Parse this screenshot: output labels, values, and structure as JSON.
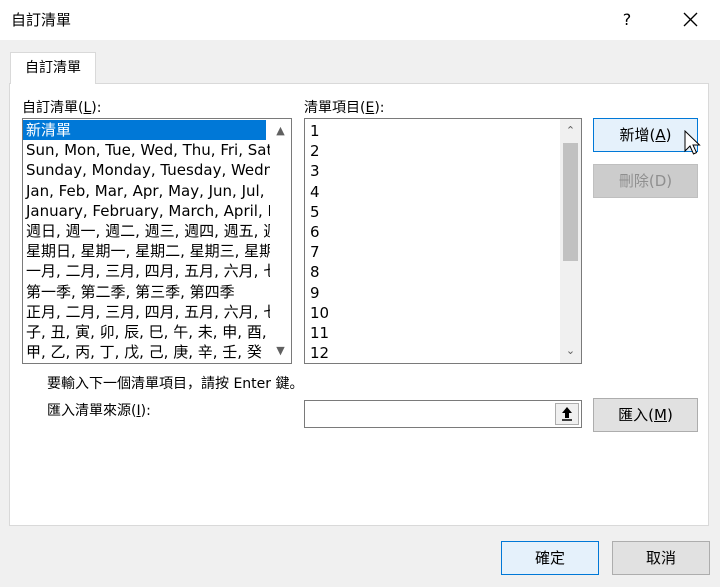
{
  "dialog": {
    "title": "自訂清單",
    "help_glyph": "?",
    "tab_label": "自訂清單"
  },
  "custom_lists": {
    "label_prefix": "自訂清單(",
    "label_key": "L",
    "label_suffix": "):",
    "items": [
      "新清單",
      "Sun, Mon, Tue, Wed, Thu, Fri, Sat",
      "Sunday, Monday, Tuesday, Wedn",
      "Jan, Feb, Mar, Apr, May, Jun, Jul, ",
      "January, February, March, April, M",
      "週日, 週一, 週二, 週三, 週四, 週五, 週",
      "星期日, 星期一, 星期二, 星期三, 星期",
      "一月, 二月, 三月, 四月, 五月, 六月, 七",
      "第一季, 第二季, 第三季, 第四季",
      "正月, 二月, 三月, 四月, 五月, 六月, 七",
      "子, 丑, 寅, 卯, 辰, 巳, 午, 未, 申, 酉, 戌",
      "甲, 乙, 丙, 丁, 戊, 己, 庚, 辛, 壬, 癸"
    ],
    "selected_index": 0
  },
  "list_entries": {
    "label_prefix": "清單項目(",
    "label_key": "E",
    "label_suffix": "):",
    "items": [
      "1",
      "2",
      "3",
      "4",
      "5",
      "6",
      "7",
      "8",
      "9",
      "10",
      "11",
      "12"
    ]
  },
  "buttons": {
    "add_prefix": "新增(",
    "add_key": "A",
    "add_suffix": ")",
    "delete_label": "刪除(D)",
    "import_prefix": "匯入(",
    "import_key": "M",
    "import_suffix": ")",
    "ok_label": "確定",
    "cancel_label": "取消"
  },
  "hint_text": "要輸入下一個清單項目，請按 Enter 鍵。",
  "import_source": {
    "label_prefix": "匯入清單來源(",
    "label_key": "I",
    "label_suffix": "):",
    "value": "",
    "ref_glyph": "↥"
  },
  "colors": {
    "selection": "#0078d7",
    "dialog_bg": "#f0f0f0"
  }
}
